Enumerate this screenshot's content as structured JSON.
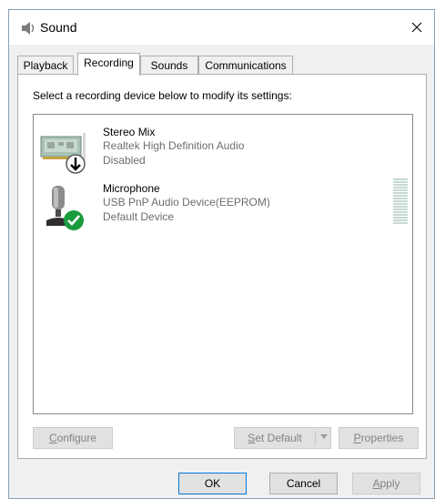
{
  "window": {
    "title": "Sound",
    "title_icon": "speaker-icon",
    "close_icon": "close-icon"
  },
  "tabs": [
    {
      "label": "Playback",
      "active": false
    },
    {
      "label": "Recording",
      "active": true
    },
    {
      "label": "Sounds",
      "active": false
    },
    {
      "label": "Communications",
      "active": false
    }
  ],
  "panel": {
    "instruction": "Select a recording device below to modify its settings:",
    "devices": [
      {
        "name": "Stereo Mix",
        "description": "Realtek High Definition Audio",
        "status": "Disabled",
        "icon": "sound-card-icon",
        "badge": "disabled-arrow-badge"
      },
      {
        "name": "Microphone",
        "description": "USB PnP Audio Device(EEPROM)",
        "status": "Default Device",
        "icon": "microphone-icon",
        "badge": "default-check-badge",
        "level": 0
      }
    ],
    "buttons": {
      "configure": {
        "first": "C",
        "rest": "onfigure"
      },
      "set_default": {
        "first": "S",
        "rest": "et Default"
      },
      "properties": {
        "first": "P",
        "rest": "roperties"
      }
    }
  },
  "footer": {
    "ok": "OK",
    "cancel": "Cancel",
    "apply": {
      "first": "A",
      "rest": "pply"
    }
  },
  "colors": {
    "accent": "#0078d7",
    "check_badge": "#1a9b3c",
    "disabled_text": "#838383"
  }
}
